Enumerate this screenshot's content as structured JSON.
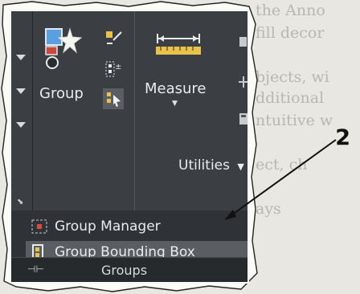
{
  "background_text": [
    "the Anno",
    "fill decor",
    "bjects, wi",
    "dditional",
    "ntuitive w",
    "ect, ch",
    "ays"
  ],
  "ribbon": {
    "group_button_label": "Group",
    "measure_button_label": "Measure",
    "utilities_label": "Utilities",
    "utilities_arrow": "▼"
  },
  "dropdown": {
    "items": [
      {
        "label": "Group Manager",
        "icon": "group-manager-icon"
      },
      {
        "label": "Group Bounding Box",
        "icon": "group-bounding-box-icon"
      }
    ],
    "panel_title": "Groups"
  },
  "callout": {
    "number": "2"
  },
  "colors": {
    "ribbon_bg": "#3b3e42",
    "menu_bg": "#2f3236",
    "highlight": "#5a5e63",
    "text": "#e9ebee",
    "accent_blue": "#3a7bd5",
    "accent_red": "#d94b3d",
    "accent_yellow": "#e8c24a"
  }
}
